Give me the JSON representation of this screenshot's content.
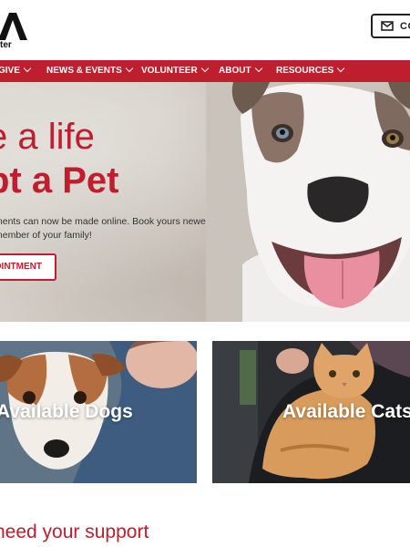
{
  "header": {
    "logo_tagline": "ter",
    "contact_label": "CO"
  },
  "nav": {
    "items": [
      {
        "label": "GIVE"
      },
      {
        "label": "NEWS & EVENTS"
      },
      {
        "label": "VOLUNTEER"
      },
      {
        "label": "ABOUT"
      },
      {
        "label": "RESOURCES"
      }
    ]
  },
  "hero": {
    "line1": "e a life",
    "line2": "pt a Pet",
    "description": "ments can now be made online. Book yours newest member of your family!",
    "cta_label": "OINTMENT"
  },
  "cards": {
    "dogs": {
      "label": "Available Dogs"
    },
    "cats": {
      "label": "Available Cats"
    }
  },
  "support": {
    "heading": "need your support"
  },
  "colors": {
    "brand_red": "#be1e2d",
    "nav_text": "#ffffff"
  }
}
